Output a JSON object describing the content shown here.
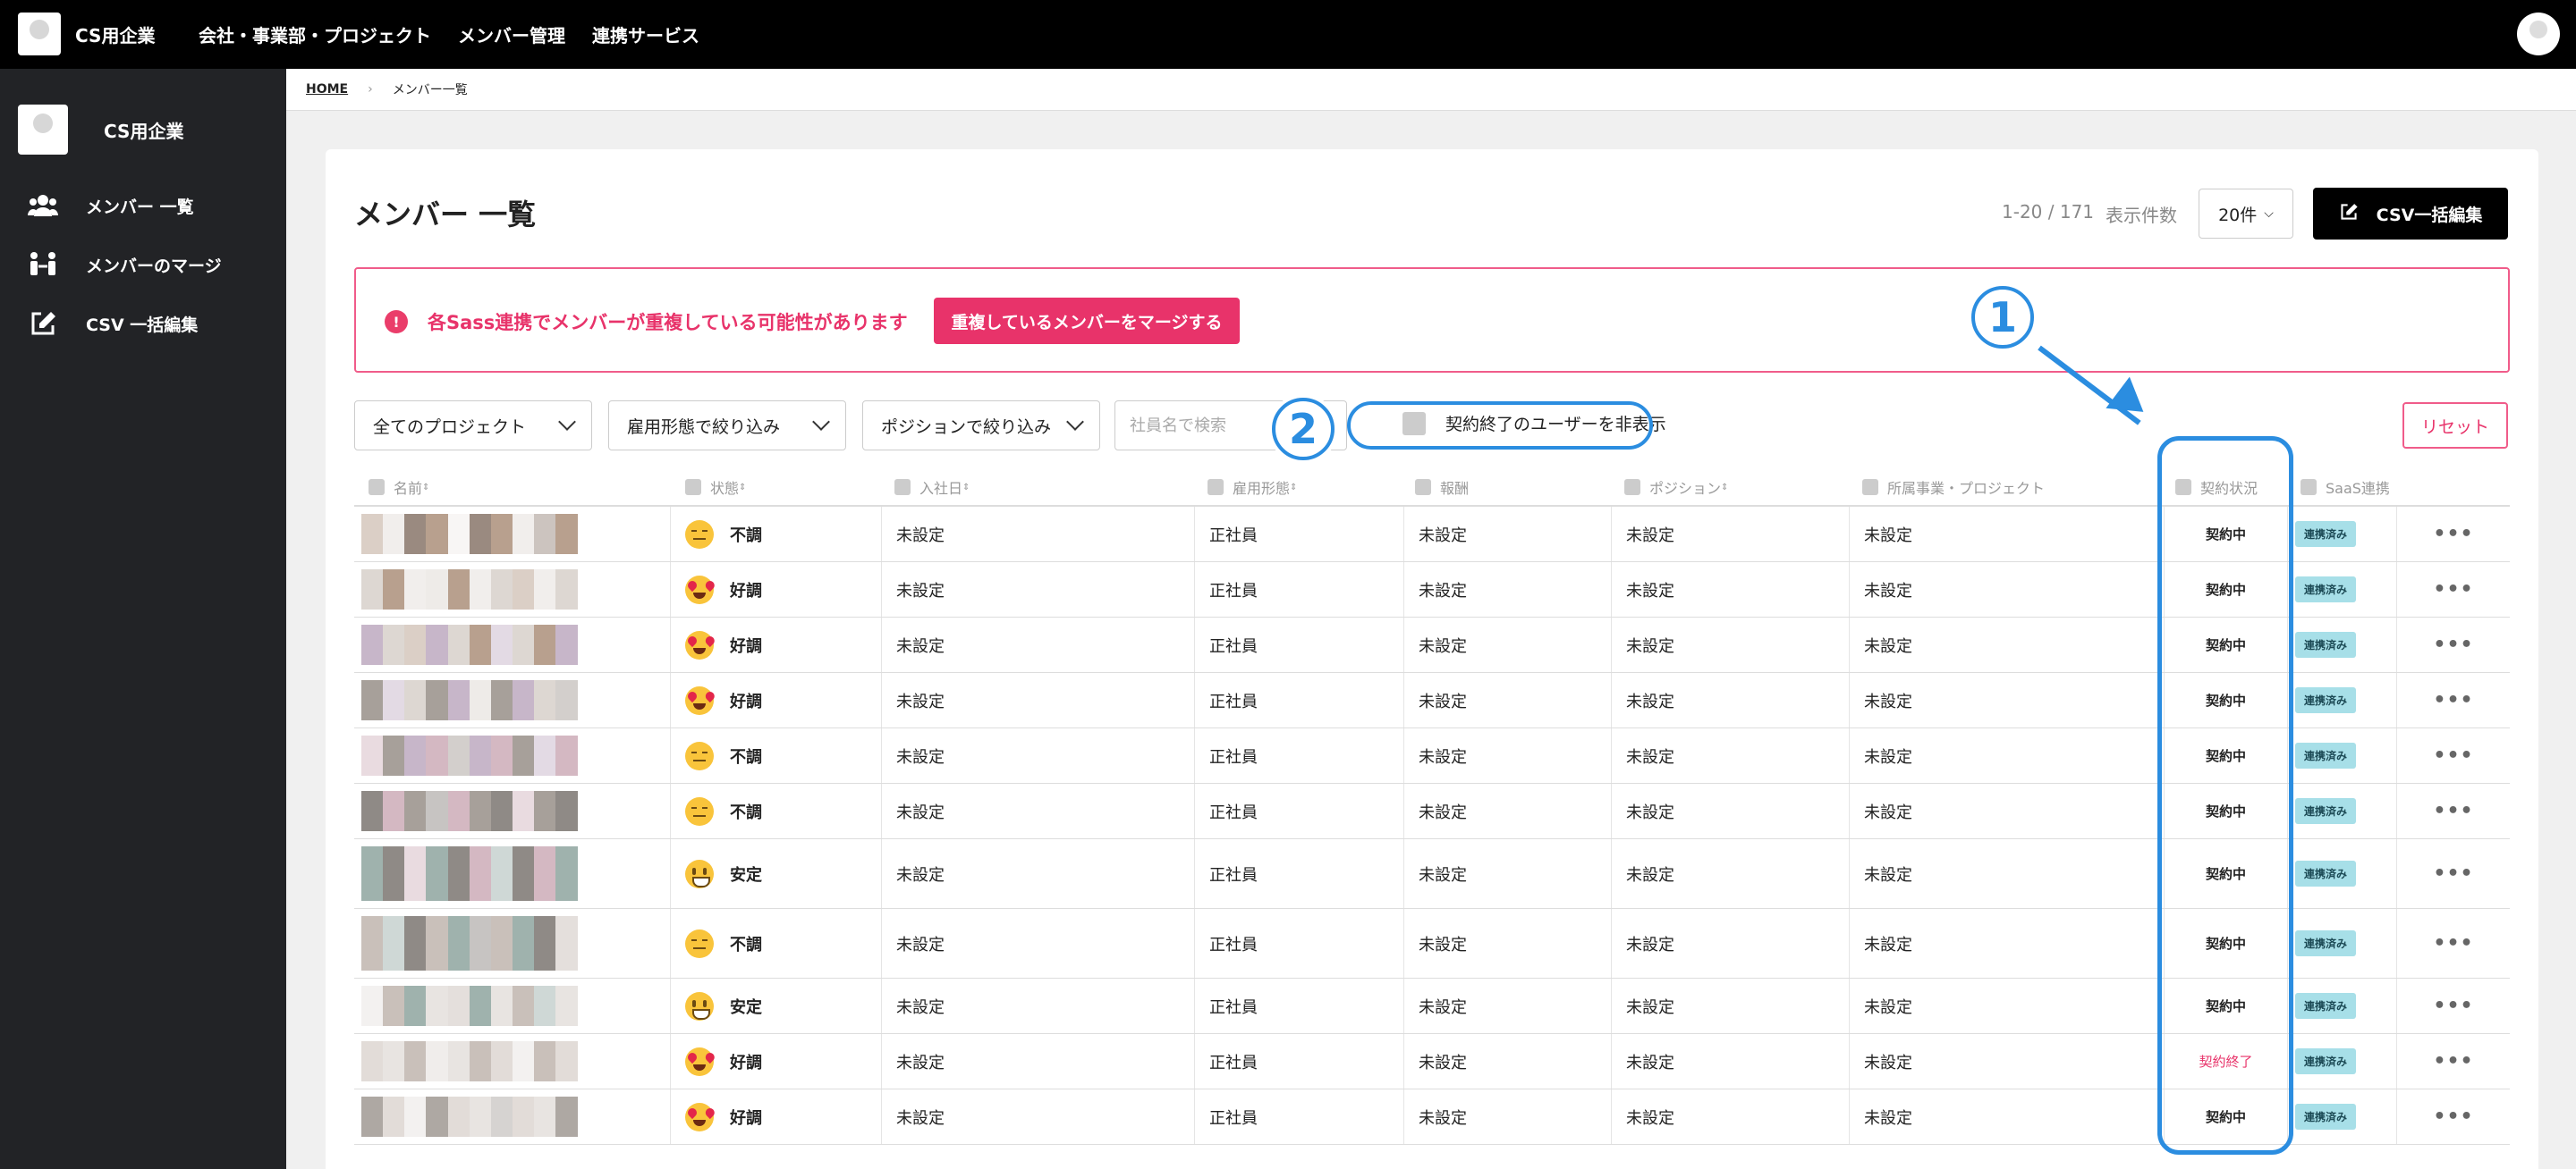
{
  "header": {
    "brand": "CS用企業",
    "nav": [
      "会社・事業部・プロジェクト",
      "メンバー管理",
      "連携サービス"
    ]
  },
  "sidebar": {
    "company": "CS用企業",
    "items": [
      {
        "label": "メンバー 一覧",
        "icon": "users-icon"
      },
      {
        "label": "メンバーのマージ",
        "icon": "merge-icon"
      },
      {
        "label": "CSV 一括編集",
        "icon": "edit-icon"
      }
    ]
  },
  "breadcrumb": {
    "home": "HOME",
    "current": "メンバー一覧"
  },
  "page": {
    "title": "メンバー 一覧",
    "count": "1-20 / 171",
    "perpage_label": "表示件数",
    "perpage_value": "20件",
    "csv_button": "CSV一括編集"
  },
  "alert": {
    "text": "各Sass連携でメンバーが重複している可能性があります",
    "button": "重複しているメンバーをマージする"
  },
  "filters": {
    "project": "全てのプロジェクト",
    "employment": "雇用形態で絞り込み",
    "position": "ポジションで絞り込み",
    "search_placeholder": "社員名で検索",
    "hide_ended": "契約終了のユーザーを非表示",
    "reset": "リセット"
  },
  "table": {
    "headers": [
      "名前",
      "状態",
      "入社日",
      "雇用形態",
      "報酬",
      "ポジション",
      "所属事業・プロジェクト",
      "契約状況",
      "SaaS連携"
    ],
    "rows": [
      {
        "status": "不調",
        "mood": "bad",
        "join": "未設定",
        "employment": "正社員",
        "pay": "未設定",
        "position": "未設定",
        "project": "未設定",
        "contract": "契約中",
        "saas": "連携済み"
      },
      {
        "status": "好調",
        "mood": "good",
        "join": "未設定",
        "employment": "正社員",
        "pay": "未設定",
        "position": "未設定",
        "project": "未設定",
        "contract": "契約中",
        "saas": "連携済み"
      },
      {
        "status": "好調",
        "mood": "good",
        "join": "未設定",
        "employment": "正社員",
        "pay": "未設定",
        "position": "未設定",
        "project": "未設定",
        "contract": "契約中",
        "saas": "連携済み"
      },
      {
        "status": "好調",
        "mood": "good",
        "join": "未設定",
        "employment": "正社員",
        "pay": "未設定",
        "position": "未設定",
        "project": "未設定",
        "contract": "契約中",
        "saas": "連携済み"
      },
      {
        "status": "不調",
        "mood": "bad",
        "join": "未設定",
        "employment": "正社員",
        "pay": "未設定",
        "position": "未設定",
        "project": "未設定",
        "contract": "契約中",
        "saas": "連携済み"
      },
      {
        "status": "不調",
        "mood": "bad",
        "join": "未設定",
        "employment": "正社員",
        "pay": "未設定",
        "position": "未設定",
        "project": "未設定",
        "contract": "契約中",
        "saas": "連携済み"
      },
      {
        "status": "安定",
        "mood": "ok",
        "join": "未設定",
        "employment": "正社員",
        "pay": "未設定",
        "position": "未設定",
        "project": "未設定",
        "contract": "契約中",
        "saas": "連携済み"
      },
      {
        "status": "不調",
        "mood": "bad",
        "join": "未設定",
        "employment": "正社員",
        "pay": "未設定",
        "position": "未設定",
        "project": "未設定",
        "contract": "契約中",
        "saas": "連携済み"
      },
      {
        "status": "安定",
        "mood": "ok",
        "join": "未設定",
        "employment": "正社員",
        "pay": "未設定",
        "position": "未設定",
        "project": "未設定",
        "contract": "契約中",
        "saas": "連携済み"
      },
      {
        "status": "好調",
        "mood": "good",
        "join": "未設定",
        "employment": "正社員",
        "pay": "未設定",
        "position": "未設定",
        "project": "未設定",
        "contract": "契約終了",
        "saas": "連携済み"
      },
      {
        "status": "好調",
        "mood": "good",
        "join": "未設定",
        "employment": "正社員",
        "pay": "未設定",
        "position": "未設定",
        "project": "未設定",
        "contract": "契約中",
        "saas": "連携済み"
      }
    ]
  },
  "annotations": {
    "marker1": "1",
    "marker2": "2",
    "accent": "#2b8de0"
  }
}
